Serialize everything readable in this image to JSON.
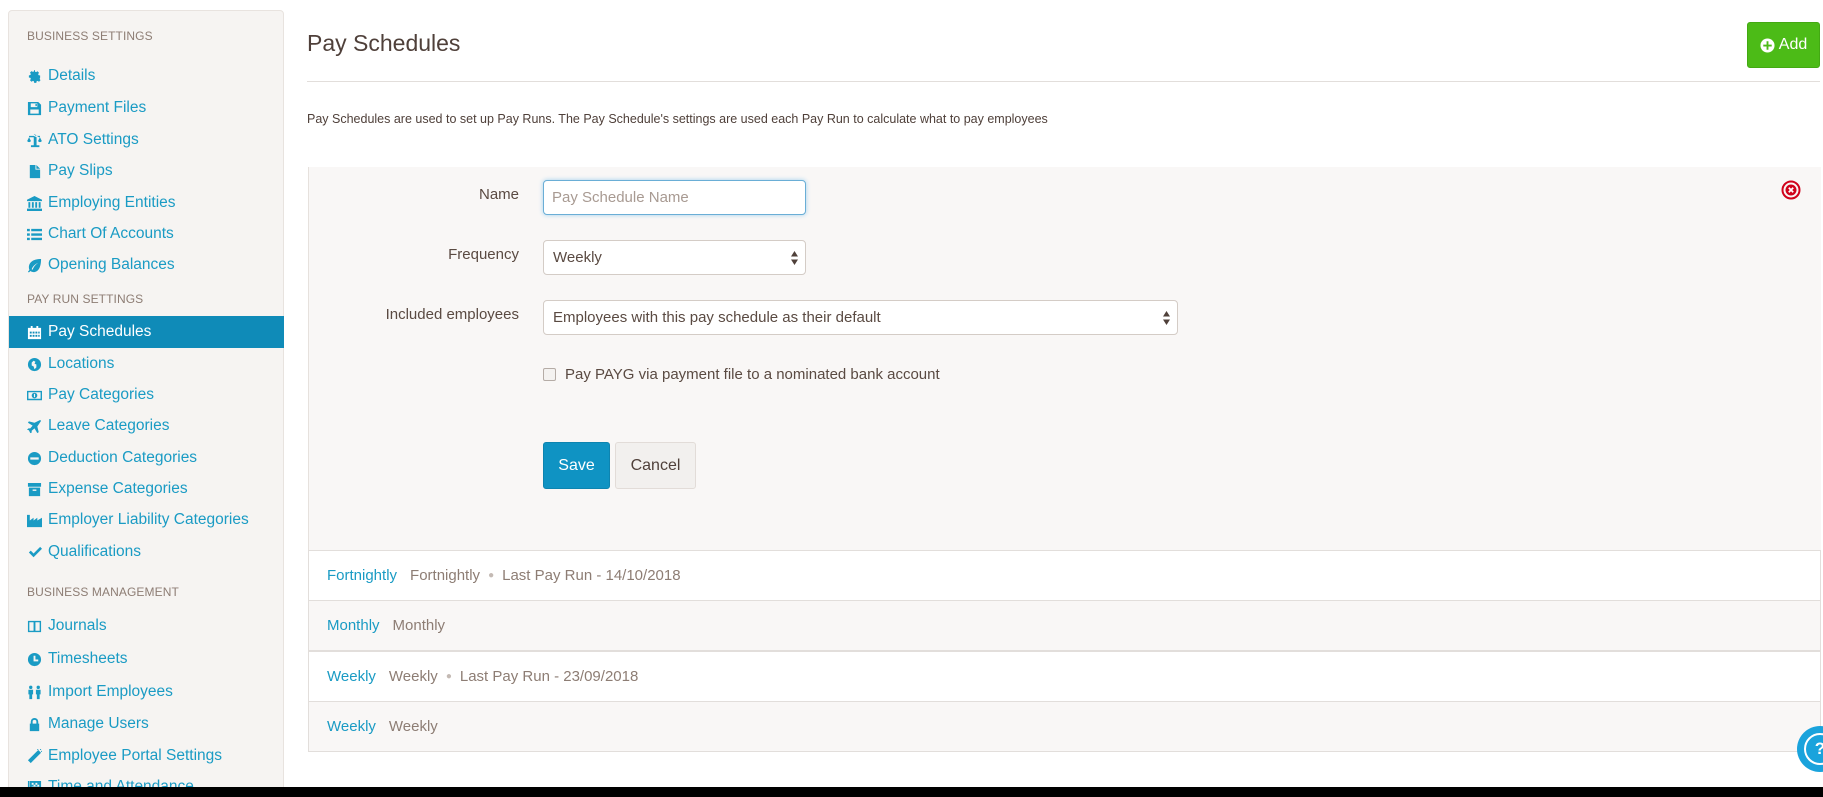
{
  "sidebar": {
    "sections": [
      {
        "heading": "BUSINESS SETTINGS",
        "items": [
          {
            "label": "Details",
            "icon": "gear-icon"
          },
          {
            "label": "Payment Files",
            "icon": "floppy-disk-icon"
          },
          {
            "label": "ATO Settings",
            "icon": "scales-icon"
          },
          {
            "label": "Pay Slips",
            "icon": "file-icon"
          },
          {
            "label": "Employing Entities",
            "icon": "bank-icon"
          },
          {
            "label": "Chart Of Accounts",
            "icon": "list-icon"
          },
          {
            "label": "Opening Balances",
            "icon": "leaf-icon"
          }
        ]
      },
      {
        "heading": "PAY RUN SETTINGS",
        "items": [
          {
            "label": "Pay Schedules",
            "icon": "calendar-icon",
            "active": true
          },
          {
            "label": "Locations",
            "icon": "globe-icon"
          },
          {
            "label": "Pay Categories",
            "icon": "money-icon"
          },
          {
            "label": "Leave Categories",
            "icon": "plane-icon"
          },
          {
            "label": "Deduction Categories",
            "icon": "minus-circle-icon"
          },
          {
            "label": "Expense Categories",
            "icon": "archive-icon"
          },
          {
            "label": "Employer Liability Categories",
            "icon": "industry-icon"
          },
          {
            "label": "Qualifications",
            "icon": "check-icon"
          }
        ]
      },
      {
        "heading": "BUSINESS MANAGEMENT",
        "items": [
          {
            "label": "Journals",
            "icon": "columns-icon"
          },
          {
            "label": "Timesheets",
            "icon": "clock-icon"
          },
          {
            "label": "Import Employees",
            "icon": "users-icon"
          },
          {
            "label": "Manage Users",
            "icon": "lock-icon"
          },
          {
            "label": "Employee Portal Settings",
            "icon": "magic-wand-icon"
          },
          {
            "label": "Time and Attendance",
            "icon": "flag-icon"
          }
        ]
      }
    ]
  },
  "header": {
    "title": "Pay Schedules",
    "add_label": "Add",
    "description": "Pay Schedules are used to set up Pay Runs. The Pay Schedule's settings are used each Pay Run to calculate what to pay employees"
  },
  "form": {
    "name_label": "Name",
    "name_value": "",
    "name_placeholder": "Pay Schedule Name",
    "frequency_label": "Frequency",
    "frequency_value": "Weekly",
    "included_label": "Included employees",
    "included_value": "Employees with this pay schedule as their default",
    "payg_label": "Pay PAYG via payment file to a nominated bank account",
    "payg_checked": false,
    "save_label": "Save",
    "cancel_label": "Cancel"
  },
  "schedules": [
    {
      "name": "Fortnightly",
      "frequency": "Fortnightly",
      "last_pay_run": "Last Pay Run - 14/10/2018"
    },
    {
      "name": "Monthly",
      "frequency": "Monthly",
      "last_pay_run": ""
    },
    {
      "name": "Weekly",
      "frequency": "Weekly",
      "last_pay_run": "Last Pay Run - 23/09/2018"
    },
    {
      "name": "Weekly",
      "frequency": "Weekly",
      "last_pay_run": ""
    }
  ],
  "help": {
    "label": "?"
  },
  "colors": {
    "accent": "#1a9bc4",
    "active_nav": "#0f8bb8",
    "add_button": "#4cbb17",
    "remove": "#d0021b"
  }
}
